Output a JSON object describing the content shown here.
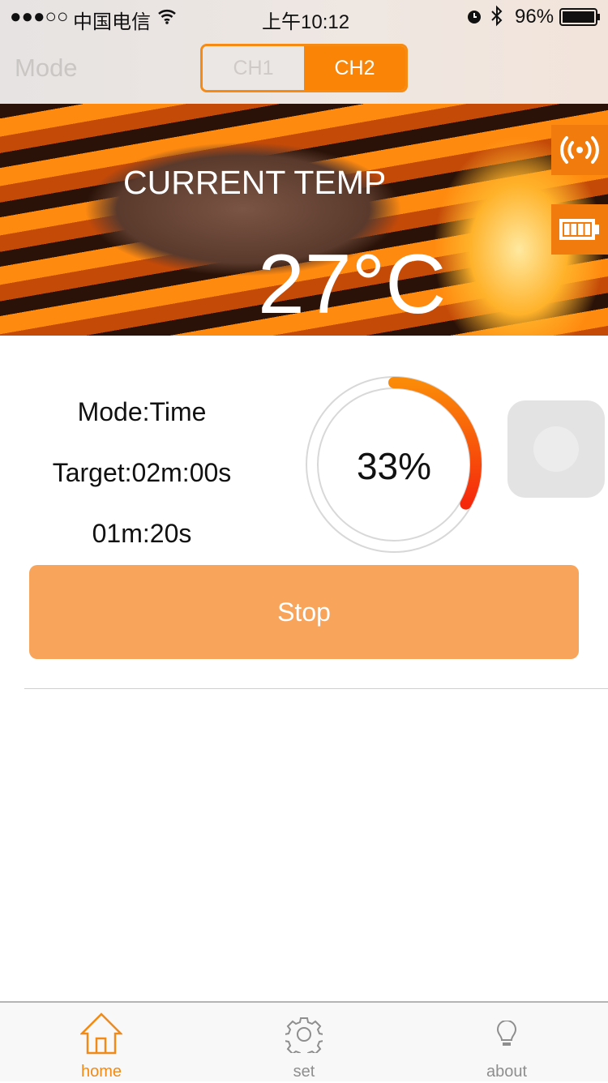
{
  "status_bar": {
    "signal": "●●●○○",
    "carrier": "中国电信",
    "time": "上午10:12",
    "battery": "96%"
  },
  "header": {
    "mode_label": "Mode",
    "channels": [
      {
        "label": "CH1",
        "selected": false
      },
      {
        "label": "CH2",
        "selected": true
      }
    ]
  },
  "hero": {
    "current_label": "CURRENT TEMP",
    "temperature": "27°C",
    "icons": [
      "signal-icon",
      "battery-icon"
    ]
  },
  "timer": {
    "mode": "Mode:Time",
    "target": "Target:02m:00s",
    "elapsed": "01m:20s",
    "progress_label": "33%",
    "progress": 0.33
  },
  "stop_label": "Stop",
  "colors": {
    "accent": "#f98406",
    "stop_button": "#f8a45a"
  },
  "tabbar": {
    "items": [
      {
        "label": "home",
        "active": true
      },
      {
        "label": "set",
        "active": false
      },
      {
        "label": "about",
        "active": false
      }
    ]
  }
}
